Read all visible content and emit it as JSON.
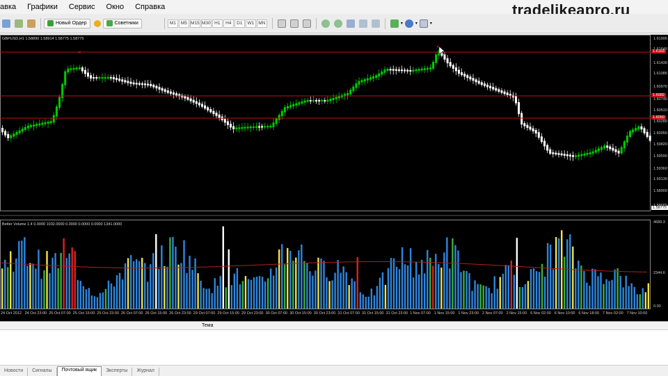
{
  "watermark": "tradelikeapro.ru",
  "menu": [
    "авка",
    "Графики",
    "Сервис",
    "Окно",
    "Справка"
  ],
  "toolbar": {
    "new_order": "Новый Ордер",
    "advisors": "Советники",
    "timeframes": [
      "M1",
      "M5",
      "M15",
      "M30",
      "H1",
      "H4",
      "D1",
      "W1",
      "MN"
    ]
  },
  "chart": {
    "info": "GBPUSD,H1  1.58890 1.58914 1.58775 1.58775",
    "last_price": "1.58775",
    "hline_labels": [
      "1.6163",
      "1.6082",
      "1.6050"
    ],
    "price_labels": [
      "1.61995",
      "1.61640",
      "1.61430",
      "1.61085",
      "1.60970",
      "1.60740",
      "1.60510",
      "1.60280",
      "1.60050",
      "1.59820",
      "1.59590",
      "1.59360",
      "1.59130",
      "1.58900",
      "1.58665"
    ],
    "indicator_info": "Better Volume 1.4 0.0000 1032.0000 0.0000 0.0000 0.0000 1341.0000",
    "vol_scale": [
      "4689.3",
      "2344.6",
      "0.00"
    ],
    "time_labels": [
      "24 Oct 2012",
      "24 Oct 23:00",
      "25 Oct 07:00",
      "25 Oct 15:00",
      "25 Oct 23:00",
      "26 Oct 07:00",
      "26 Oct 15:00",
      "26 Oct 23:00",
      "29 Oct 07:00",
      "29 Oct 15:00",
      "29 Oct 23:00",
      "30 Oct 07:00",
      "30 Oct 15:00",
      "30 Oct 23:00",
      "31 Oct 07:00",
      "31 Oct 15:00",
      "31 Oct 23:00",
      "1 Nov 07:00",
      "1 Nov 15:00",
      "1 Nov 23:00",
      "2 Nov 07:00",
      "2 Nov 15:00",
      "6 Nov 02:00",
      "6 Nov 10:00",
      "6 Nov 18:00",
      "7 Nov 02:00",
      "7 Nov 10:00"
    ],
    "colors": {
      "bg": "#000000",
      "bull": "#00cc00",
      "bear": "#ffffff",
      "hline": "#c01010",
      "vol_blue": "#2e86de",
      "vol_red": "#e02020",
      "vol_yellow": "#f2e24a",
      "vol_green": "#3cb03c",
      "vol_white": "#ffffff",
      "ma": "#b02020"
    }
  },
  "bottom": {
    "column": "Тема",
    "tabs": [
      "Новости",
      "Сигналы",
      "Почтовый ящик",
      "Эксперты",
      "Журнал"
    ],
    "active_tab": 2
  }
}
